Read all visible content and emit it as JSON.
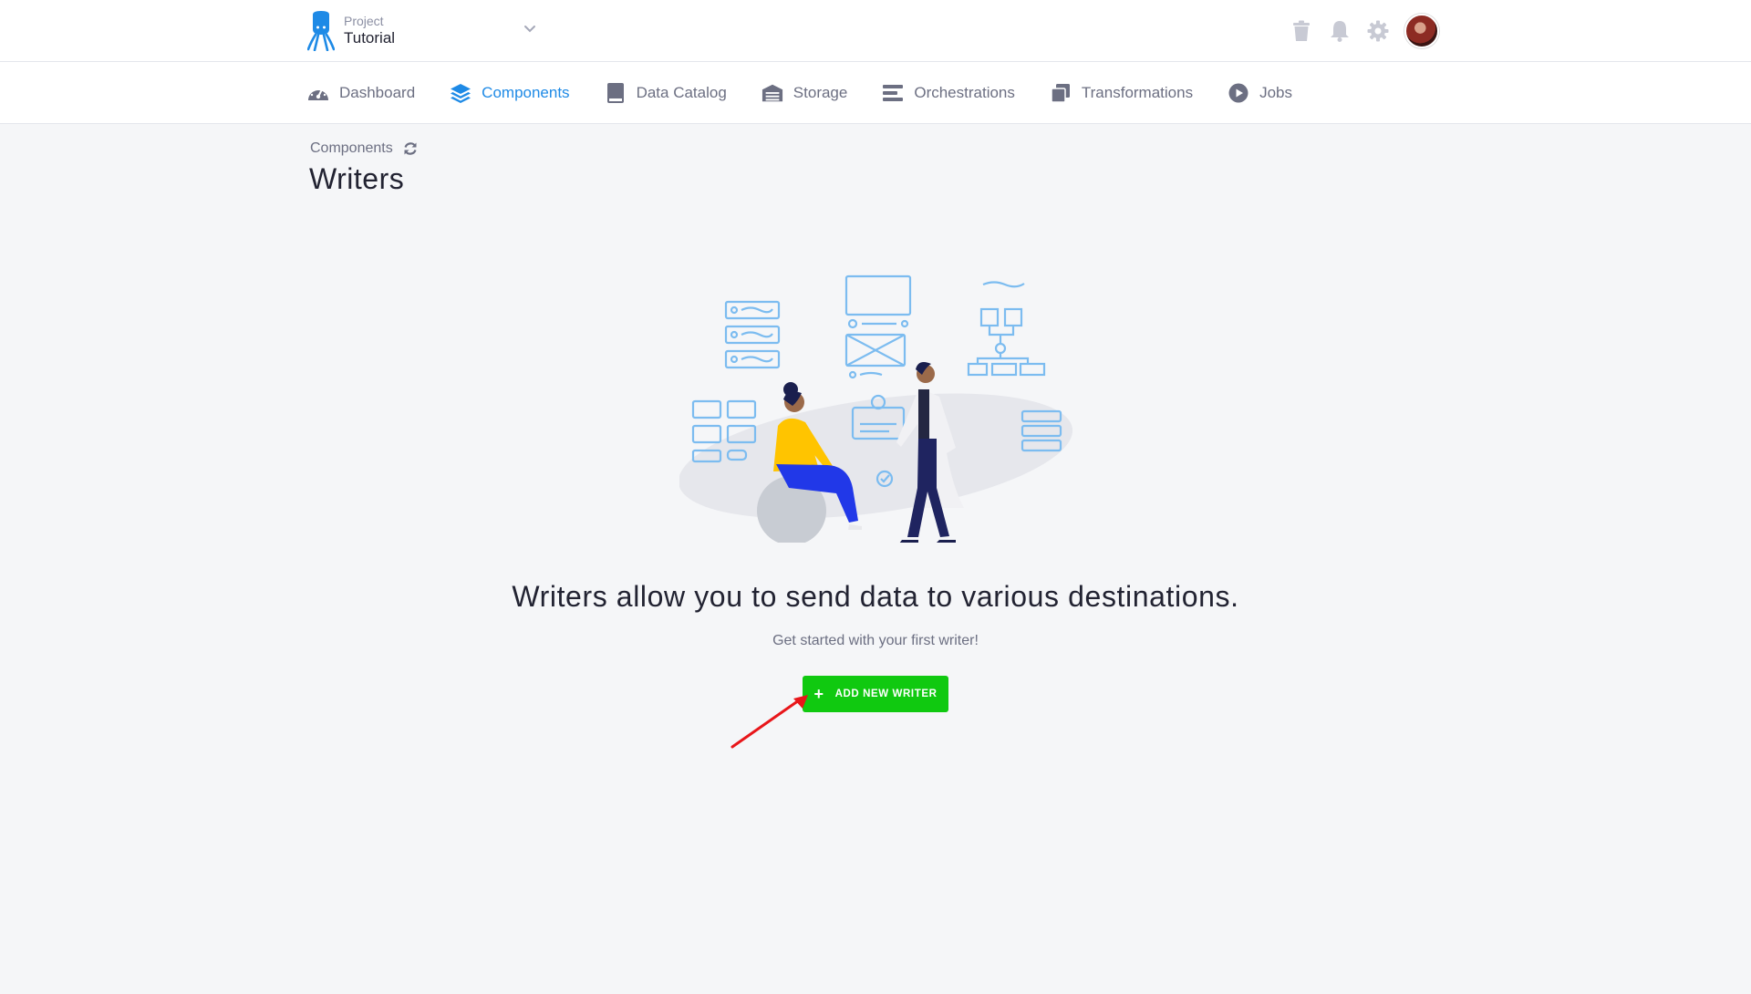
{
  "header": {
    "project_label": "Project",
    "project_name": "Tutorial",
    "icons": [
      "trash-icon",
      "bell-icon",
      "gear-icon",
      "avatar"
    ]
  },
  "nav": {
    "items": [
      {
        "label": "Dashboard",
        "icon": "gauge-icon"
      },
      {
        "label": "Components",
        "icon": "layers-icon",
        "active": true
      },
      {
        "label": "Data Catalog",
        "icon": "book-icon"
      },
      {
        "label": "Storage",
        "icon": "warehouse-icon"
      },
      {
        "label": "Orchestrations",
        "icon": "list-icon"
      },
      {
        "label": "Transformations",
        "icon": "copy-icon"
      },
      {
        "label": "Jobs",
        "icon": "play-circle-icon"
      }
    ]
  },
  "page": {
    "breadcrumb": "Components",
    "title": "Writers"
  },
  "empty_state": {
    "title": "Writers allow you to send data to various destinations.",
    "subtitle": "Get started with your first writer!",
    "button_label": "ADD NEW WRITER",
    "button_icon": "plus-icon"
  },
  "colors": {
    "accent": "#1e8ae6",
    "button_green": "#10c910",
    "annotation_arrow": "#e8161a"
  }
}
